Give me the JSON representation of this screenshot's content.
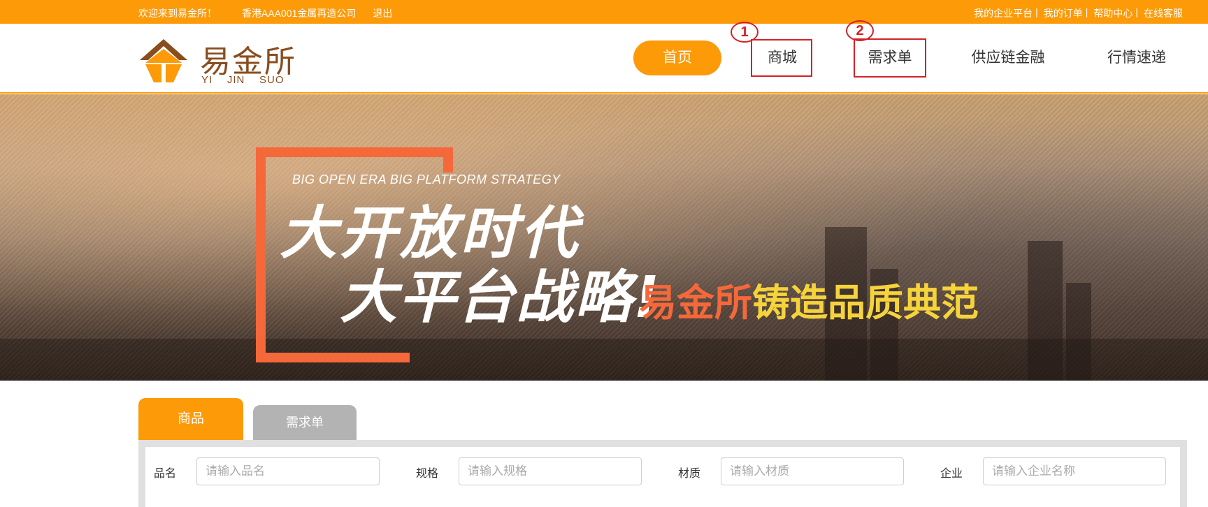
{
  "topbar": {
    "welcome": "欢迎来到易金所！",
    "company": "香港AAA001金属再造公司",
    "logout": "退出",
    "links": [
      "我的企业平台",
      "我的订单",
      "帮助中心",
      "在线客服"
    ],
    "separator": "|"
  },
  "logo": {
    "cn": "易金所",
    "en": "YI    JIN    SUO"
  },
  "nav": {
    "home": "首页",
    "mall": "商城",
    "demand": "需求单",
    "finance": "供应链金融",
    "market": "行情速递"
  },
  "annotations": {
    "marker1": "1",
    "marker2": "2",
    "color": "#d42128"
  },
  "banner": {
    "en": "BIG OPEN ERA BIG PLATFORM STRATEGY",
    "line1": "大开放时代",
    "line2": "大平台战略!",
    "brand_orange": "易金所",
    "brand_yellow": "铸造品质典范"
  },
  "search": {
    "tabs": [
      "商品",
      "需求单"
    ],
    "fields": [
      {
        "label": "品名",
        "placeholder": "请输入品名"
      },
      {
        "label": "规格",
        "placeholder": "请输入规格"
      },
      {
        "label": "材质",
        "placeholder": "请输入材质"
      },
      {
        "label": "企业",
        "placeholder": "请输入企业名称"
      }
    ]
  },
  "colors": {
    "accent": "#fc9a08",
    "logo_brown": "#8a4d1e",
    "banner_orange": "#f4683a",
    "banner_yellow": "#f5d33b"
  }
}
